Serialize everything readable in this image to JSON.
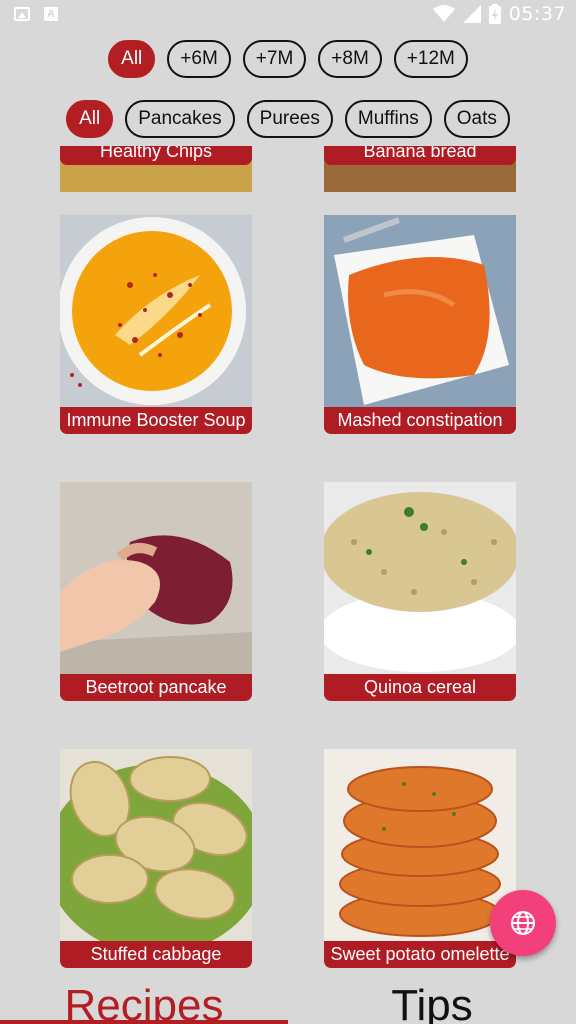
{
  "status_bar": {
    "time": "05:37"
  },
  "age_filters": [
    {
      "label": "All",
      "active": true
    },
    {
      "label": "+6M",
      "active": false
    },
    {
      "label": "+7M",
      "active": false
    },
    {
      "label": "+8M",
      "active": false
    },
    {
      "label": "+12M",
      "active": false
    }
  ],
  "category_filters": [
    {
      "label": "All",
      "active": true
    },
    {
      "label": "Pancakes",
      "active": false
    },
    {
      "label": "Purees",
      "active": false
    },
    {
      "label": "Muffins",
      "active": false
    },
    {
      "label": "Oats",
      "active": false
    }
  ],
  "recipes": [
    {
      "title": "Healthy Chips"
    },
    {
      "title": "Banana bread"
    },
    {
      "title": "Immune Booster Soup"
    },
    {
      "title": "Mashed constipation"
    },
    {
      "title": "Beetroot pancake"
    },
    {
      "title": "Quinoa cereal"
    },
    {
      "title": "Stuffed cabbage"
    },
    {
      "title": "Sweet potato omelette"
    }
  ],
  "fab": {
    "icon": "globe-icon"
  },
  "tabs": [
    {
      "label": "Recipes",
      "active": true
    },
    {
      "label": "Tips",
      "active": false
    }
  ],
  "colors": {
    "accent": "#b21e22",
    "fab": "#f3407a",
    "background": "#d8d8d8"
  }
}
